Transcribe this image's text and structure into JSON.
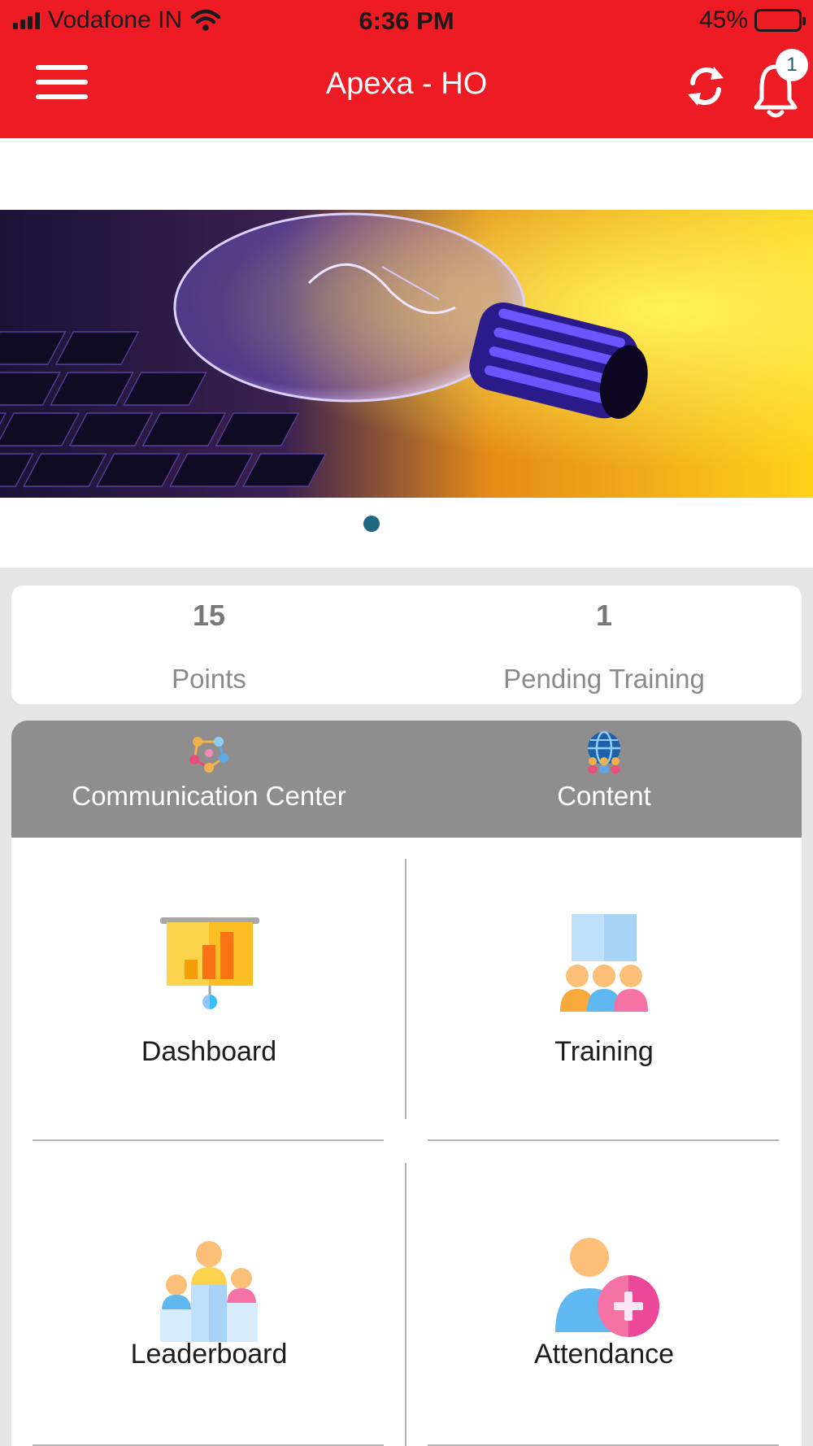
{
  "status_bar": {
    "carrier": "Vodafone IN",
    "time": "6:36 PM",
    "battery": "45%",
    "battery_level": 0.45
  },
  "header": {
    "title": "Apexa - HO",
    "menu_icon": "hamburger-menu-icon",
    "sync_icon": "sync-icon",
    "bell_icon": "bell-icon",
    "notification_count": "1",
    "colors": {
      "primary": "#ed1c24",
      "badge_text": "#1f5a7a"
    }
  },
  "banner": {
    "image": "lightbulb-on-keyboard",
    "active_dot_color": "#1f6a80"
  },
  "stats": [
    {
      "value": "15",
      "label": "Points"
    },
    {
      "value": "1",
      "label": "Pending Training"
    }
  ],
  "tabs": [
    {
      "label": "Communication Center",
      "icon": "network-people-icon"
    },
    {
      "label": "Content",
      "icon": "globe-people-icon"
    }
  ],
  "tiles": [
    {
      "label": "Dashboard",
      "icon": "presentation-chart-icon"
    },
    {
      "label": "Training",
      "icon": "classroom-icon"
    },
    {
      "label": "Leaderboard",
      "icon": "podium-icon"
    },
    {
      "label": "Attendance",
      "icon": "add-user-icon"
    }
  ]
}
